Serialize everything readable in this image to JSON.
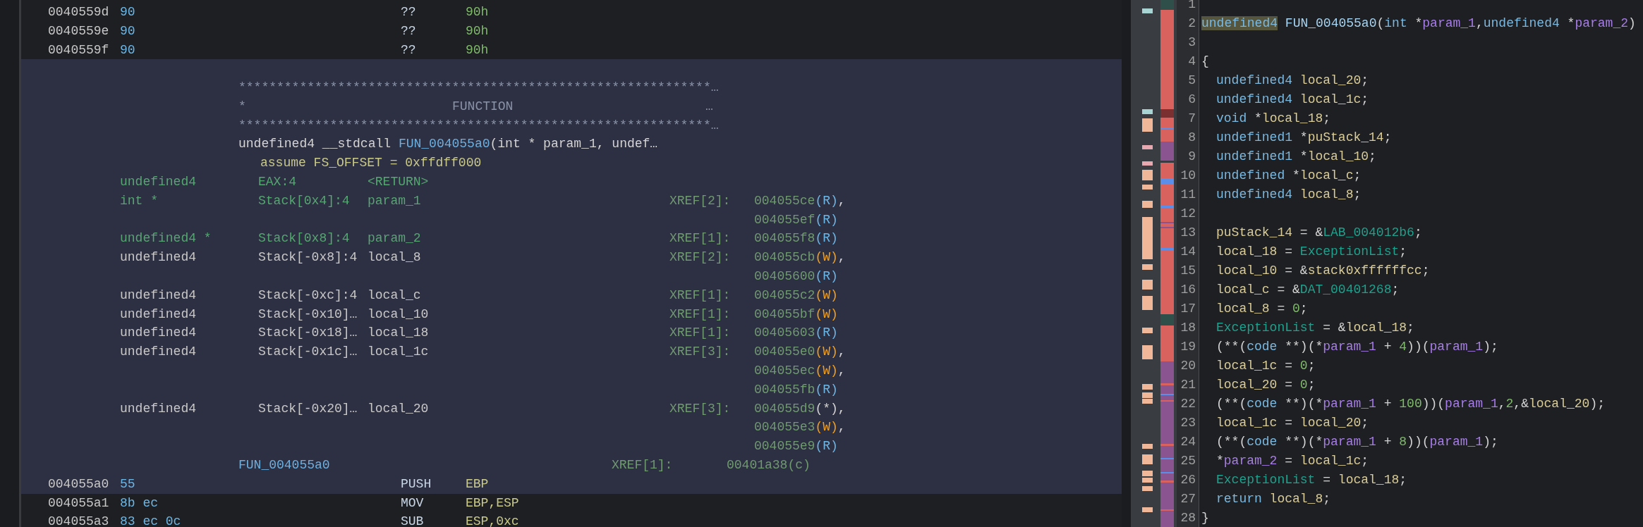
{
  "listing": {
    "instructions_before": [
      {
        "address": "0040559d",
        "bytes": "90",
        "mnemonic": "??",
        "operand": {
          "text": "90h",
          "kind": "data"
        }
      },
      {
        "address": "0040559e",
        "bytes": "90",
        "mnemonic": "??",
        "operand": {
          "text": "90h",
          "kind": "data"
        }
      },
      {
        "address": "0040559f",
        "bytes": "90",
        "mnemonic": "??",
        "operand": {
          "text": "90h",
          "kind": "data"
        }
      }
    ],
    "function": {
      "rows": [
        {
          "kind": "banner",
          "text": "**************************************************************…"
        },
        {
          "kind": "banner_title",
          "star": "*",
          "title": "FUNCTION",
          "more": "…"
        },
        {
          "kind": "banner",
          "text": "**************************************************************…"
        },
        {
          "kind": "signature",
          "return_type": "undefined4",
          "convention": "__stdcall",
          "name": "FUN_004055a0",
          "params": "(int * param_1, undef…"
        },
        {
          "kind": "assume",
          "text": "assume FS_OFFSET = 0xffdff000"
        },
        {
          "kind": "param",
          "type": "undefined4",
          "storage": "EAX:4",
          "name": "<RETURN>"
        },
        {
          "kind": "param",
          "type": "int *",
          "storage": "Stack[0x4]:4",
          "name": "param_1",
          "xref_label": "XREF[2]:",
          "xref": {
            "address": "004055ce",
            "access": "(R)",
            "kind": "read",
            "separator": ","
          }
        },
        {
          "kind": "xref",
          "xref": {
            "address": "004055ef",
            "access": "(R)",
            "kind": "read"
          }
        },
        {
          "kind": "param",
          "type": "undefined4 *",
          "storage": "Stack[0x8]:4",
          "name": "param_2",
          "xref_label": "XREF[1]:",
          "xref": {
            "address": "004055f8",
            "access": "(R)",
            "kind": "read"
          }
        },
        {
          "kind": "local",
          "type": "undefined4",
          "storage": "Stack[-0x8]:4",
          "name": "local_8",
          "xref_label": "XREF[2]:",
          "xref": {
            "address": "004055cb",
            "access": "(W)",
            "kind": "write",
            "separator": ","
          }
        },
        {
          "kind": "xref",
          "xref": {
            "address": "00405600",
            "access": "(R)",
            "kind": "read"
          }
        },
        {
          "kind": "local",
          "type": "undefined4",
          "storage": "Stack[-0xc]:4",
          "name": "local_c",
          "xref_label": "XREF[1]:",
          "xref": {
            "address": "004055c2",
            "access": "(W)",
            "kind": "write"
          }
        },
        {
          "kind": "local",
          "type": "undefined4",
          "storage": "Stack[-0x10]…",
          "name": "local_10",
          "xref_label": "XREF[1]:",
          "xref": {
            "address": "004055bf",
            "access": "(W)",
            "kind": "write"
          }
        },
        {
          "kind": "local",
          "type": "undefined4",
          "storage": "Stack[-0x18]…",
          "name": "local_18",
          "xref_label": "XREF[1]:",
          "xref": {
            "address": "00405603",
            "access": "(R)",
            "kind": "read"
          }
        },
        {
          "kind": "local",
          "type": "undefined4",
          "storage": "Stack[-0x1c]…",
          "name": "local_1c",
          "xref_label": "XREF[3]:",
          "xref": {
            "address": "004055e0",
            "access": "(W)",
            "kind": "write",
            "separator": ","
          }
        },
        {
          "kind": "xref",
          "xref": {
            "address": "004055ec",
            "access": "(W)",
            "kind": "write",
            "separator": ","
          }
        },
        {
          "kind": "xref",
          "xref": {
            "address": "004055fb",
            "access": "(R)",
            "kind": "read"
          }
        },
        {
          "kind": "local",
          "type": "undefined4",
          "storage": "Stack[-0x20]…",
          "name": "local_20",
          "xref_label": "XREF[3]:",
          "xref": {
            "address": "004055d9",
            "access": "(*)",
            "kind": "other",
            "separator": ","
          }
        },
        {
          "kind": "xref",
          "xref": {
            "address": "004055e3",
            "access": "(W)",
            "kind": "write",
            "separator": ","
          }
        },
        {
          "kind": "xref",
          "xref": {
            "address": "004055e9",
            "access": "(R)",
            "kind": "read"
          }
        },
        {
          "kind": "label",
          "name": "FUN_004055a0",
          "xref_label": "XREF[1]:",
          "xref": {
            "address": "00401a38",
            "access": "(c)",
            "kind": "call"
          }
        },
        {
          "kind": "instruction",
          "address": "004055a0",
          "bytes": "55",
          "mnemonic": "PUSH",
          "operand": {
            "text": "EBP",
            "kind": "register"
          }
        }
      ]
    },
    "instructions_after": [
      {
        "address": "004055a1",
        "bytes": "8b ec",
        "mnemonic": "MOV",
        "operand": {
          "text": "EBP,ESP",
          "kind": "register"
        }
      },
      {
        "address": "004055a3",
        "bytes": "83 ec 0c",
        "mnemonic": "SUB",
        "operand": {
          "text": "ESP,0xc",
          "kind": "register"
        }
      }
    ]
  },
  "decompiler": {
    "lines": [
      {
        "number": "1"
      },
      {
        "number": "2",
        "indented": false,
        "tokens": [
          {
            "text": "undefined4",
            "kind": "highlight"
          },
          {
            "text": " FUN_004055a0",
            "kind": "func"
          },
          {
            "text": "(",
            "kind": "plain"
          },
          {
            "text": "int",
            "kind": "type"
          },
          {
            "text": " *",
            "kind": "plain"
          },
          {
            "text": "param_1",
            "kind": "param"
          },
          {
            "text": ",",
            "kind": "plain"
          },
          {
            "text": "undefined4",
            "kind": "type"
          },
          {
            "text": " *",
            "kind": "plain"
          },
          {
            "text": "param_2",
            "kind": "param"
          },
          {
            "text": ")",
            "kind": "plain"
          }
        ]
      },
      {
        "number": "3"
      },
      {
        "number": "4",
        "indented": false,
        "tokens": [
          {
            "text": "{",
            "kind": "plain"
          }
        ]
      },
      {
        "number": "5",
        "indented": true,
        "tokens": [
          {
            "text": "undefined4",
            "kind": "type"
          },
          {
            "text": " local_20",
            "kind": "local"
          },
          {
            "text": ";",
            "kind": "plain"
          }
        ]
      },
      {
        "number": "6",
        "indented": true,
        "tokens": [
          {
            "text": "undefined4",
            "kind": "type"
          },
          {
            "text": " local_1c",
            "kind": "local"
          },
          {
            "text": ";",
            "kind": "plain"
          }
        ]
      },
      {
        "number": "7",
        "indented": true,
        "tokens": [
          {
            "text": "void",
            "kind": "type"
          },
          {
            "text": " *",
            "kind": "plain"
          },
          {
            "text": "local_18",
            "kind": "local"
          },
          {
            "text": ";",
            "kind": "plain"
          }
        ]
      },
      {
        "number": "8",
        "indented": true,
        "tokens": [
          {
            "text": "undefined1",
            "kind": "type"
          },
          {
            "text": " *",
            "kind": "plain"
          },
          {
            "text": "puStack_14",
            "kind": "local"
          },
          {
            "text": ";",
            "kind": "plain"
          }
        ]
      },
      {
        "number": "9",
        "indented": true,
        "tokens": [
          {
            "text": "undefined1",
            "kind": "type"
          },
          {
            "text": " *",
            "kind": "plain"
          },
          {
            "text": "local_10",
            "kind": "local"
          },
          {
            "text": ";",
            "kind": "plain"
          }
        ]
      },
      {
        "number": "10",
        "indented": true,
        "tokens": [
          {
            "text": "undefined",
            "kind": "type"
          },
          {
            "text": " *",
            "kind": "plain"
          },
          {
            "text": "local_c",
            "kind": "local"
          },
          {
            "text": ";",
            "kind": "plain"
          }
        ]
      },
      {
        "number": "11",
        "indented": true,
        "tokens": [
          {
            "text": "undefined4",
            "kind": "type"
          },
          {
            "text": " local_8",
            "kind": "local"
          },
          {
            "text": ";",
            "kind": "plain"
          }
        ]
      },
      {
        "number": "12"
      },
      {
        "number": "13",
        "indented": true,
        "tokens": [
          {
            "text": "puStack_14",
            "kind": "local"
          },
          {
            "text": " = &",
            "kind": "plain"
          },
          {
            "text": "LAB_004012b6",
            "kind": "global"
          },
          {
            "text": ";",
            "kind": "plain"
          }
        ]
      },
      {
        "number": "14",
        "indented": true,
        "tokens": [
          {
            "text": "local_18",
            "kind": "local"
          },
          {
            "text": " = ",
            "kind": "plain"
          },
          {
            "text": "ExceptionList",
            "kind": "global"
          },
          {
            "text": ";",
            "kind": "plain"
          }
        ]
      },
      {
        "number": "15",
        "indented": true,
        "tokens": [
          {
            "text": "local_10",
            "kind": "local"
          },
          {
            "text": " = &",
            "kind": "plain"
          },
          {
            "text": "stack0xffffffcc",
            "kind": "local"
          },
          {
            "text": ";",
            "kind": "plain"
          }
        ]
      },
      {
        "number": "16",
        "indented": true,
        "tokens": [
          {
            "text": "local_c",
            "kind": "local"
          },
          {
            "text": " = &",
            "kind": "plain"
          },
          {
            "text": "DAT_00401268",
            "kind": "global"
          },
          {
            "text": ";",
            "kind": "plain"
          }
        ]
      },
      {
        "number": "17",
        "indented": true,
        "tokens": [
          {
            "text": "local_8",
            "kind": "local"
          },
          {
            "text": " = ",
            "kind": "plain"
          },
          {
            "text": "0",
            "kind": "number"
          },
          {
            "text": ";",
            "kind": "plain"
          }
        ]
      },
      {
        "number": "18",
        "indented": true,
        "tokens": [
          {
            "text": "ExceptionList",
            "kind": "global"
          },
          {
            "text": " = &",
            "kind": "plain"
          },
          {
            "text": "local_18",
            "kind": "local"
          },
          {
            "text": ";",
            "kind": "plain"
          }
        ]
      },
      {
        "number": "19",
        "indented": true,
        "tokens": [
          {
            "text": "(**(",
            "kind": "plain"
          },
          {
            "text": "code",
            "kind": "type"
          },
          {
            "text": " **)(*",
            "kind": "plain"
          },
          {
            "text": "param_1",
            "kind": "param"
          },
          {
            "text": " + ",
            "kind": "plain"
          },
          {
            "text": "4",
            "kind": "number"
          },
          {
            "text": "))(",
            "kind": "plain"
          },
          {
            "text": "param_1",
            "kind": "param"
          },
          {
            "text": ");",
            "kind": "plain"
          }
        ]
      },
      {
        "number": "20",
        "indented": true,
        "tokens": [
          {
            "text": "local_1c",
            "kind": "local"
          },
          {
            "text": " = ",
            "kind": "plain"
          },
          {
            "text": "0",
            "kind": "number"
          },
          {
            "text": ";",
            "kind": "plain"
          }
        ]
      },
      {
        "number": "21",
        "indented": true,
        "tokens": [
          {
            "text": "local_20",
            "kind": "local"
          },
          {
            "text": " = ",
            "kind": "plain"
          },
          {
            "text": "0",
            "kind": "number"
          },
          {
            "text": ";",
            "kind": "plain"
          }
        ]
      },
      {
        "number": "22",
        "indented": true,
        "tokens": [
          {
            "text": "(**(",
            "kind": "plain"
          },
          {
            "text": "code",
            "kind": "type"
          },
          {
            "text": " **)(*",
            "kind": "plain"
          },
          {
            "text": "param_1",
            "kind": "param"
          },
          {
            "text": " + ",
            "kind": "plain"
          },
          {
            "text": "100",
            "kind": "number"
          },
          {
            "text": "))(",
            "kind": "plain"
          },
          {
            "text": "param_1",
            "kind": "param"
          },
          {
            "text": ",",
            "kind": "plain"
          },
          {
            "text": "2",
            "kind": "number"
          },
          {
            "text": ",&",
            "kind": "plain"
          },
          {
            "text": "local_20",
            "kind": "local"
          },
          {
            "text": ");",
            "kind": "plain"
          }
        ]
      },
      {
        "number": "23",
        "indented": true,
        "tokens": [
          {
            "text": "local_1c",
            "kind": "local"
          },
          {
            "text": " = ",
            "kind": "plain"
          },
          {
            "text": "local_20",
            "kind": "local"
          },
          {
            "text": ";",
            "kind": "plain"
          }
        ]
      },
      {
        "number": "24",
        "indented": true,
        "tokens": [
          {
            "text": "(**(",
            "kind": "plain"
          },
          {
            "text": "code",
            "kind": "type"
          },
          {
            "text": " **)(*",
            "kind": "plain"
          },
          {
            "text": "param_1",
            "kind": "param"
          },
          {
            "text": " + ",
            "kind": "plain"
          },
          {
            "text": "8",
            "kind": "number"
          },
          {
            "text": "))(",
            "kind": "plain"
          },
          {
            "text": "param_1",
            "kind": "param"
          },
          {
            "text": ");",
            "kind": "plain"
          }
        ]
      },
      {
        "number": "25",
        "indented": true,
        "tokens": [
          {
            "text": "*",
            "kind": "plain"
          },
          {
            "text": "param_2",
            "kind": "param"
          },
          {
            "text": " = ",
            "kind": "plain"
          },
          {
            "text": "local_1c",
            "kind": "local"
          },
          {
            "text": ";",
            "kind": "plain"
          }
        ]
      },
      {
        "number": "26",
        "indented": true,
        "tokens": [
          {
            "text": "ExceptionList",
            "kind": "global"
          },
          {
            "text": " = ",
            "kind": "plain"
          },
          {
            "text": "local_18",
            "kind": "local"
          },
          {
            "text": ";",
            "kind": "plain"
          }
        ]
      },
      {
        "number": "27",
        "indented": true,
        "tokens": [
          {
            "text": "return",
            "kind": "keyword"
          },
          {
            "text": " local_8",
            "kind": "local"
          },
          {
            "text": ";",
            "kind": "plain"
          }
        ]
      },
      {
        "number": "28",
        "indented": false,
        "tokens": [
          {
            "text": "}",
            "kind": "plain"
          }
        ]
      }
    ]
  }
}
